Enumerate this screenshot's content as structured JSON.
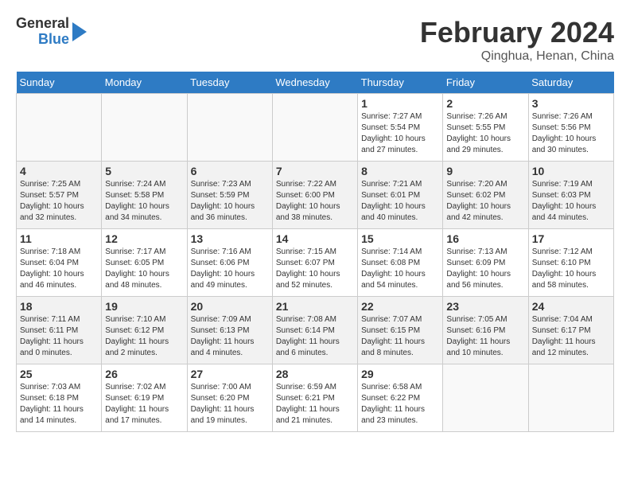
{
  "header": {
    "logo_general": "General",
    "logo_blue": "Blue",
    "month_title": "February 2024",
    "location": "Qinghua, Henan, China"
  },
  "weekdays": [
    "Sunday",
    "Monday",
    "Tuesday",
    "Wednesday",
    "Thursday",
    "Friday",
    "Saturday"
  ],
  "weeks": [
    [
      {
        "day": "",
        "info": ""
      },
      {
        "day": "",
        "info": ""
      },
      {
        "day": "",
        "info": ""
      },
      {
        "day": "",
        "info": ""
      },
      {
        "day": "1",
        "info": "Sunrise: 7:27 AM\nSunset: 5:54 PM\nDaylight: 10 hours\nand 27 minutes."
      },
      {
        "day": "2",
        "info": "Sunrise: 7:26 AM\nSunset: 5:55 PM\nDaylight: 10 hours\nand 29 minutes."
      },
      {
        "day": "3",
        "info": "Sunrise: 7:26 AM\nSunset: 5:56 PM\nDaylight: 10 hours\nand 30 minutes."
      }
    ],
    [
      {
        "day": "4",
        "info": "Sunrise: 7:25 AM\nSunset: 5:57 PM\nDaylight: 10 hours\nand 32 minutes."
      },
      {
        "day": "5",
        "info": "Sunrise: 7:24 AM\nSunset: 5:58 PM\nDaylight: 10 hours\nand 34 minutes."
      },
      {
        "day": "6",
        "info": "Sunrise: 7:23 AM\nSunset: 5:59 PM\nDaylight: 10 hours\nand 36 minutes."
      },
      {
        "day": "7",
        "info": "Sunrise: 7:22 AM\nSunset: 6:00 PM\nDaylight: 10 hours\nand 38 minutes."
      },
      {
        "day": "8",
        "info": "Sunrise: 7:21 AM\nSunset: 6:01 PM\nDaylight: 10 hours\nand 40 minutes."
      },
      {
        "day": "9",
        "info": "Sunrise: 7:20 AM\nSunset: 6:02 PM\nDaylight: 10 hours\nand 42 minutes."
      },
      {
        "day": "10",
        "info": "Sunrise: 7:19 AM\nSunset: 6:03 PM\nDaylight: 10 hours\nand 44 minutes."
      }
    ],
    [
      {
        "day": "11",
        "info": "Sunrise: 7:18 AM\nSunset: 6:04 PM\nDaylight: 10 hours\nand 46 minutes."
      },
      {
        "day": "12",
        "info": "Sunrise: 7:17 AM\nSunset: 6:05 PM\nDaylight: 10 hours\nand 48 minutes."
      },
      {
        "day": "13",
        "info": "Sunrise: 7:16 AM\nSunset: 6:06 PM\nDaylight: 10 hours\nand 49 minutes."
      },
      {
        "day": "14",
        "info": "Sunrise: 7:15 AM\nSunset: 6:07 PM\nDaylight: 10 hours\nand 52 minutes."
      },
      {
        "day": "15",
        "info": "Sunrise: 7:14 AM\nSunset: 6:08 PM\nDaylight: 10 hours\nand 54 minutes."
      },
      {
        "day": "16",
        "info": "Sunrise: 7:13 AM\nSunset: 6:09 PM\nDaylight: 10 hours\nand 56 minutes."
      },
      {
        "day": "17",
        "info": "Sunrise: 7:12 AM\nSunset: 6:10 PM\nDaylight: 10 hours\nand 58 minutes."
      }
    ],
    [
      {
        "day": "18",
        "info": "Sunrise: 7:11 AM\nSunset: 6:11 PM\nDaylight: 11 hours\nand 0 minutes."
      },
      {
        "day": "19",
        "info": "Sunrise: 7:10 AM\nSunset: 6:12 PM\nDaylight: 11 hours\nand 2 minutes."
      },
      {
        "day": "20",
        "info": "Sunrise: 7:09 AM\nSunset: 6:13 PM\nDaylight: 11 hours\nand 4 minutes."
      },
      {
        "day": "21",
        "info": "Sunrise: 7:08 AM\nSunset: 6:14 PM\nDaylight: 11 hours\nand 6 minutes."
      },
      {
        "day": "22",
        "info": "Sunrise: 7:07 AM\nSunset: 6:15 PM\nDaylight: 11 hours\nand 8 minutes."
      },
      {
        "day": "23",
        "info": "Sunrise: 7:05 AM\nSunset: 6:16 PM\nDaylight: 11 hours\nand 10 minutes."
      },
      {
        "day": "24",
        "info": "Sunrise: 7:04 AM\nSunset: 6:17 PM\nDaylight: 11 hours\nand 12 minutes."
      }
    ],
    [
      {
        "day": "25",
        "info": "Sunrise: 7:03 AM\nSunset: 6:18 PM\nDaylight: 11 hours\nand 14 minutes."
      },
      {
        "day": "26",
        "info": "Sunrise: 7:02 AM\nSunset: 6:19 PM\nDaylight: 11 hours\nand 17 minutes."
      },
      {
        "day": "27",
        "info": "Sunrise: 7:00 AM\nSunset: 6:20 PM\nDaylight: 11 hours\nand 19 minutes."
      },
      {
        "day": "28",
        "info": "Sunrise: 6:59 AM\nSunset: 6:21 PM\nDaylight: 11 hours\nand 21 minutes."
      },
      {
        "day": "29",
        "info": "Sunrise: 6:58 AM\nSunset: 6:22 PM\nDaylight: 11 hours\nand 23 minutes."
      },
      {
        "day": "",
        "info": ""
      },
      {
        "day": "",
        "info": ""
      }
    ]
  ]
}
